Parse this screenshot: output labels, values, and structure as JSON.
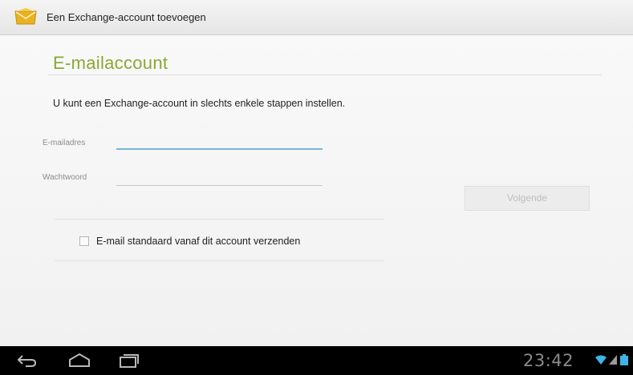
{
  "titlebar": {
    "app_icon": "email-envelope-icon",
    "title": "Een Exchange-account toevoegen"
  },
  "main": {
    "section_title": "E-mailaccount",
    "intro": "U kunt een Exchange-account in slechts enkele stappen instellen.",
    "email": {
      "label": "E-mailadres",
      "value": ""
    },
    "password": {
      "label": "Wachtwoord",
      "value": ""
    },
    "next_label": "Volgende",
    "checkbox": {
      "label": "E-mail standaard vanaf dit account verzenden",
      "checked": false
    }
  },
  "navbar": {
    "icons": [
      "back-icon",
      "home-icon",
      "recent-apps-icon"
    ],
    "time": "23:42",
    "status_icons": [
      "wifi-icon",
      "signal-icon",
      "battery-icon"
    ]
  },
  "colors": {
    "accent_green": "#8aa832",
    "focus_blue": "#7ab3d8",
    "navbar": "#000000"
  }
}
